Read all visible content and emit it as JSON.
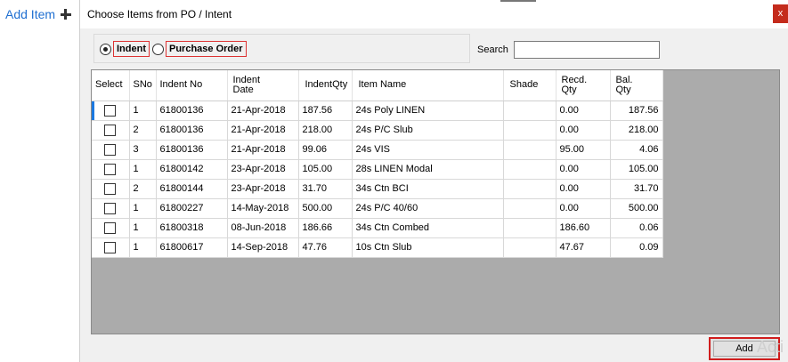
{
  "background_panel": {
    "add_item_label": "Add Item",
    "add_item_icon": "plus-icon"
  },
  "dialog": {
    "title": "Choose Items from PO / Intent",
    "close_label": "x",
    "close_color": "#c42b1c"
  },
  "source_options": {
    "selected": "Indent",
    "items": [
      {
        "label": "Indent",
        "checked": true
      },
      {
        "label": "Purchase Order",
        "checked": false
      }
    ]
  },
  "search": {
    "label": "Search",
    "value": "",
    "placeholder": ""
  },
  "grid": {
    "columns": [
      "Select",
      "SNo",
      "Indent No",
      "Indent\nDate",
      "IndentQty",
      "Item Name",
      "Shade",
      "Recd.\nQty",
      "Bal.\nQty"
    ],
    "rows": [
      {
        "select": false,
        "sno": "1",
        "indent_no": "61800136",
        "indent_date": "21-Apr-2018",
        "indent_qty": "187.56",
        "item_name": "24s Poly  LINEN",
        "shade": "",
        "recd_qty": "0.00",
        "bal_qty": "187.56"
      },
      {
        "select": false,
        "sno": "2",
        "indent_no": "61800136",
        "indent_date": "21-Apr-2018",
        "indent_qty": "218.00",
        "item_name": "24s P/C Slub",
        "shade": "",
        "recd_qty": "0.00",
        "bal_qty": "218.00"
      },
      {
        "select": false,
        "sno": "3",
        "indent_no": "61800136",
        "indent_date": "21-Apr-2018",
        "indent_qty": "99.06",
        "item_name": "24s VIS",
        "shade": "",
        "recd_qty": "95.00",
        "bal_qty": "4.06"
      },
      {
        "select": false,
        "sno": "1",
        "indent_no": "61800142",
        "indent_date": "23-Apr-2018",
        "indent_qty": "105.00",
        "item_name": "28s LINEN Modal",
        "shade": "",
        "recd_qty": "0.00",
        "bal_qty": "105.00"
      },
      {
        "select": false,
        "sno": "2",
        "indent_no": "61800144",
        "indent_date": "23-Apr-2018",
        "indent_qty": "31.70",
        "item_name": "34s Ctn  BCI",
        "shade": "",
        "recd_qty": "0.00",
        "bal_qty": "31.70"
      },
      {
        "select": false,
        "sno": "1",
        "indent_no": "61800227",
        "indent_date": "14-May-2018",
        "indent_qty": "500.00",
        "item_name": "24s P/C  40/60",
        "shade": "",
        "recd_qty": "0.00",
        "bal_qty": "500.00"
      },
      {
        "select": false,
        "sno": "1",
        "indent_no": "61800318",
        "indent_date": "08-Jun-2018",
        "indent_qty": "186.66",
        "item_name": "34s Ctn Combed",
        "shade": "",
        "recd_qty": "186.60",
        "bal_qty": "0.06"
      },
      {
        "select": false,
        "sno": "1",
        "indent_no": "61800617",
        "indent_date": "14-Sep-2018",
        "indent_qty": "47.76",
        "item_name": "10s Ctn Slub",
        "shade": "",
        "recd_qty": "47.67",
        "bal_qty": "0.09"
      }
    ]
  },
  "footer": {
    "add_button_label": "Add",
    "watermark_text": "Acti"
  }
}
